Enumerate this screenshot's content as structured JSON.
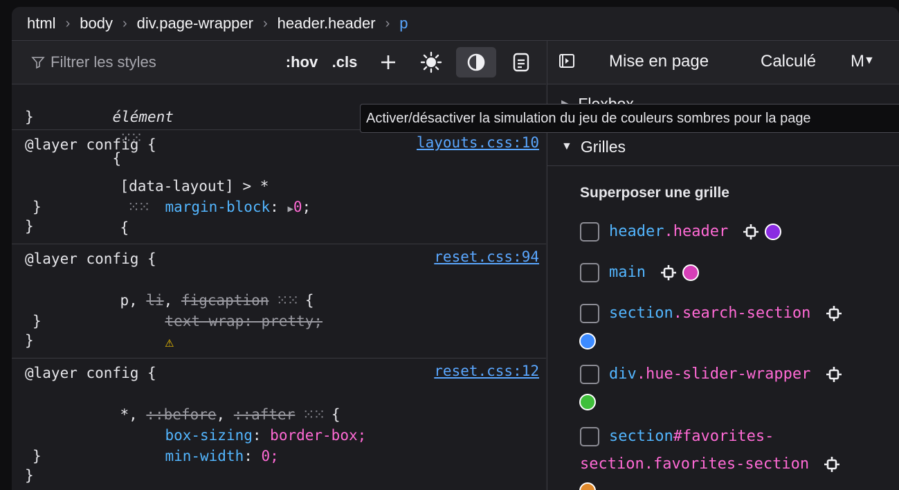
{
  "breadcrumb": [
    "html",
    "body",
    "div.page-wrapper",
    "header.header",
    "p"
  ],
  "toolbar": {
    "filter_placeholder": "Filtrer les styles",
    "hov": ":hov",
    "cls": ".cls",
    "icons": [
      "plus-icon",
      "sun-icon",
      "dark-mode-icon",
      "document-icon"
    ]
  },
  "rules": {
    "r0": {
      "l1": "élément",
      "l1b": "{",
      "l2": "}"
    },
    "r1": {
      "l1": "@layer config {",
      "src": "layouts.css:10",
      "l2": "[data-layout] > *",
      "l2b": "{",
      "prop": "margin-block",
      "val": "0",
      "l4": "}",
      "l5": "}"
    },
    "r2": {
      "l1": "@layer config {",
      "src": "reset.css:94",
      "sel_p": "p, ",
      "sel_li": "li",
      "sel_comma": ", ",
      "sel_fig": "figcaption",
      "l2b": "{",
      "prop": "text-wrap: pretty;",
      "l4": "}",
      "l5": "}"
    },
    "r3": {
      "l1": "@layer config {",
      "src": "reset.css:12",
      "sel_star": "*, ",
      "sel_before": "::before",
      "sel_comma": ", ",
      "sel_after": "::after",
      "l2b": "{",
      "prop1": "box-sizing",
      "val1": "border-box;",
      "prop2": "min-width",
      "val2": "0;",
      "l5": "}",
      "l6": "}"
    }
  },
  "right": {
    "tabs": [
      "Mise en page",
      "Calculé",
      "M"
    ],
    "flex_section": "Flexbox",
    "grid_section": "Grilles",
    "overlay_title": "Superposer une grille",
    "grids": [
      {
        "tag": "header",
        "cls": ".header",
        "color": "#8a2be2"
      },
      {
        "tag": "main",
        "cls": "",
        "color": "#d63fb7"
      },
      {
        "tag": "section",
        "cls": ".search-section",
        "color": "#3d8bff"
      },
      {
        "tag": "div",
        "cls": ".hue-slider-wrapper",
        "color": "#3fbf3a"
      },
      {
        "tag": "section",
        "cls": "#favorites-",
        "cls2": "section.favorites-section",
        "color": "#e08a2d"
      }
    ]
  },
  "tooltip": "Activer/désactiver la simulation du jeu de couleurs sombres pour la page"
}
